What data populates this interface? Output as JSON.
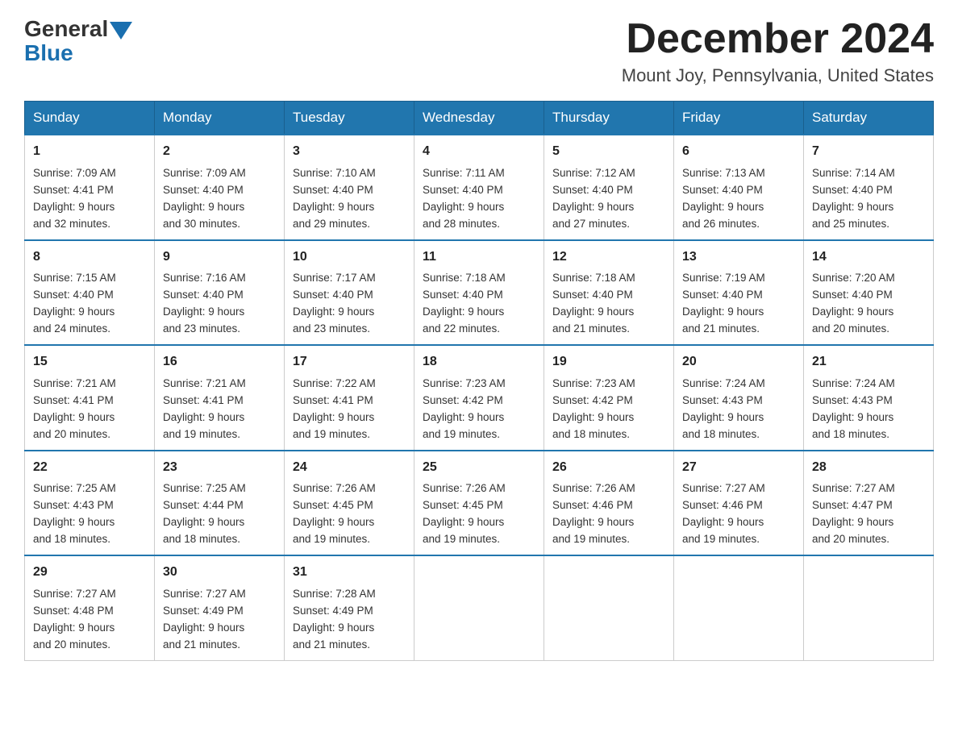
{
  "header": {
    "logo_general": "General",
    "logo_blue": "Blue",
    "month_title": "December 2024",
    "location": "Mount Joy, Pennsylvania, United States"
  },
  "days_of_week": [
    "Sunday",
    "Monday",
    "Tuesday",
    "Wednesday",
    "Thursday",
    "Friday",
    "Saturday"
  ],
  "weeks": [
    [
      {
        "day": "1",
        "sunrise": "7:09 AM",
        "sunset": "4:41 PM",
        "daylight": "9 hours and 32 minutes."
      },
      {
        "day": "2",
        "sunrise": "7:09 AM",
        "sunset": "4:40 PM",
        "daylight": "9 hours and 30 minutes."
      },
      {
        "day": "3",
        "sunrise": "7:10 AM",
        "sunset": "4:40 PM",
        "daylight": "9 hours and 29 minutes."
      },
      {
        "day": "4",
        "sunrise": "7:11 AM",
        "sunset": "4:40 PM",
        "daylight": "9 hours and 28 minutes."
      },
      {
        "day": "5",
        "sunrise": "7:12 AM",
        "sunset": "4:40 PM",
        "daylight": "9 hours and 27 minutes."
      },
      {
        "day": "6",
        "sunrise": "7:13 AM",
        "sunset": "4:40 PM",
        "daylight": "9 hours and 26 minutes."
      },
      {
        "day": "7",
        "sunrise": "7:14 AM",
        "sunset": "4:40 PM",
        "daylight": "9 hours and 25 minutes."
      }
    ],
    [
      {
        "day": "8",
        "sunrise": "7:15 AM",
        "sunset": "4:40 PM",
        "daylight": "9 hours and 24 minutes."
      },
      {
        "day": "9",
        "sunrise": "7:16 AM",
        "sunset": "4:40 PM",
        "daylight": "9 hours and 23 minutes."
      },
      {
        "day": "10",
        "sunrise": "7:17 AM",
        "sunset": "4:40 PM",
        "daylight": "9 hours and 23 minutes."
      },
      {
        "day": "11",
        "sunrise": "7:18 AM",
        "sunset": "4:40 PM",
        "daylight": "9 hours and 22 minutes."
      },
      {
        "day": "12",
        "sunrise": "7:18 AM",
        "sunset": "4:40 PM",
        "daylight": "9 hours and 21 minutes."
      },
      {
        "day": "13",
        "sunrise": "7:19 AM",
        "sunset": "4:40 PM",
        "daylight": "9 hours and 21 minutes."
      },
      {
        "day": "14",
        "sunrise": "7:20 AM",
        "sunset": "4:40 PM",
        "daylight": "9 hours and 20 minutes."
      }
    ],
    [
      {
        "day": "15",
        "sunrise": "7:21 AM",
        "sunset": "4:41 PM",
        "daylight": "9 hours and 20 minutes."
      },
      {
        "day": "16",
        "sunrise": "7:21 AM",
        "sunset": "4:41 PM",
        "daylight": "9 hours and 19 minutes."
      },
      {
        "day": "17",
        "sunrise": "7:22 AM",
        "sunset": "4:41 PM",
        "daylight": "9 hours and 19 minutes."
      },
      {
        "day": "18",
        "sunrise": "7:23 AM",
        "sunset": "4:42 PM",
        "daylight": "9 hours and 19 minutes."
      },
      {
        "day": "19",
        "sunrise": "7:23 AM",
        "sunset": "4:42 PM",
        "daylight": "9 hours and 18 minutes."
      },
      {
        "day": "20",
        "sunrise": "7:24 AM",
        "sunset": "4:43 PM",
        "daylight": "9 hours and 18 minutes."
      },
      {
        "day": "21",
        "sunrise": "7:24 AM",
        "sunset": "4:43 PM",
        "daylight": "9 hours and 18 minutes."
      }
    ],
    [
      {
        "day": "22",
        "sunrise": "7:25 AM",
        "sunset": "4:43 PM",
        "daylight": "9 hours and 18 minutes."
      },
      {
        "day": "23",
        "sunrise": "7:25 AM",
        "sunset": "4:44 PM",
        "daylight": "9 hours and 18 minutes."
      },
      {
        "day": "24",
        "sunrise": "7:26 AM",
        "sunset": "4:45 PM",
        "daylight": "9 hours and 19 minutes."
      },
      {
        "day": "25",
        "sunrise": "7:26 AM",
        "sunset": "4:45 PM",
        "daylight": "9 hours and 19 minutes."
      },
      {
        "day": "26",
        "sunrise": "7:26 AM",
        "sunset": "4:46 PM",
        "daylight": "9 hours and 19 minutes."
      },
      {
        "day": "27",
        "sunrise": "7:27 AM",
        "sunset": "4:46 PM",
        "daylight": "9 hours and 19 minutes."
      },
      {
        "day": "28",
        "sunrise": "7:27 AM",
        "sunset": "4:47 PM",
        "daylight": "9 hours and 20 minutes."
      }
    ],
    [
      {
        "day": "29",
        "sunrise": "7:27 AM",
        "sunset": "4:48 PM",
        "daylight": "9 hours and 20 minutes."
      },
      {
        "day": "30",
        "sunrise": "7:27 AM",
        "sunset": "4:49 PM",
        "daylight": "9 hours and 21 minutes."
      },
      {
        "day": "31",
        "sunrise": "7:28 AM",
        "sunset": "4:49 PM",
        "daylight": "9 hours and 21 minutes."
      },
      null,
      null,
      null,
      null
    ]
  ],
  "labels": {
    "sunrise": "Sunrise:",
    "sunset": "Sunset:",
    "daylight": "Daylight:"
  }
}
